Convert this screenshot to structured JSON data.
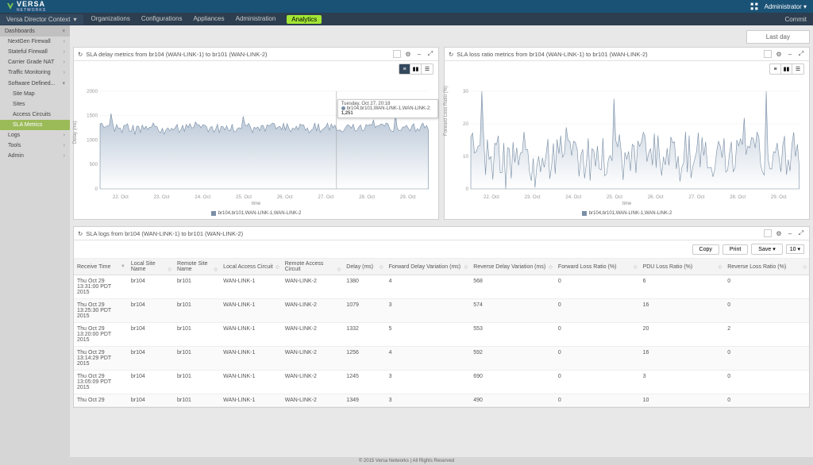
{
  "brand": {
    "name": "VERSA",
    "sub": "NETWORKS"
  },
  "user": {
    "name": "Administrator"
  },
  "context": "Versa Director Context",
  "nav": {
    "items": [
      "Organizations",
      "Configurations",
      "Appliances",
      "Administration",
      "Analytics"
    ],
    "active": 4,
    "commit": "Commit"
  },
  "timerange": "Last day",
  "sidebar": {
    "header": "Dashboards",
    "groups": [
      {
        "label": "NextGen Firewall"
      },
      {
        "label": "Stateful Firewall"
      },
      {
        "label": "Carrier Grade NAT"
      },
      {
        "label": "Traffic Monitoring"
      },
      {
        "label": "Software Defined...",
        "open": true,
        "children": [
          {
            "label": "Site Map"
          },
          {
            "label": "Sites"
          },
          {
            "label": "Access Circuits"
          },
          {
            "label": "SLA Metrics",
            "selected": true
          }
        ]
      },
      {
        "label": "Logs"
      },
      {
        "label": "Tools"
      },
      {
        "label": "Admin"
      }
    ]
  },
  "panels": {
    "delay": {
      "title": "SLA delay metrics from br104 (WAN-LINK-1) to br101 (WAN-LINK-2)",
      "ylabel": "Delay (ms)",
      "xlabel": "time",
      "legend": "br104,br101,WAN-LINK-1,WAN-LINK-2",
      "tooltip": {
        "header": "Tuesday, Oct 27, 20:18",
        "series": "br104,br101,WAN-LINK-1,WAN-LINK-2:",
        "value": "1,251"
      }
    },
    "loss": {
      "title": "SLA loss ratio metrics from br104 (WAN-LINK-1) to br101 (WAN-LINK-2)",
      "ylabel": "Forward Loss Ratio (%)",
      "xlabel": "time",
      "legend": "br104,br101,WAN-LINK-1,WAN-LINK-2"
    },
    "logs": {
      "title": "SLA logs from br104 (WAN-LINK-1) to br101 (WAN-LINK-2)",
      "buttons": {
        "copy": "Copy",
        "print": "Print",
        "save": "Save"
      },
      "pagesize": "10"
    }
  },
  "chart_data": [
    {
      "type": "area",
      "title": "SLA delay metrics from br104 (WAN-LINK-1) to br101 (WAN-LINK-2)",
      "xlabel": "time",
      "ylabel": "Delay (ms)",
      "ylim": [
        0,
        2000
      ],
      "yticks": [
        0,
        500,
        1000,
        1500,
        2000
      ],
      "xticks": [
        "22. Oct",
        "23. Oct",
        "24. Oct",
        "25. Oct",
        "26. Oct",
        "27. Oct",
        "28. Oct",
        "29. Oct"
      ],
      "series": [
        {
          "name": "br104,br101,WAN-LINK-1,WAN-LINK-2",
          "approx_mean": 1250,
          "approx_min": 1100,
          "approx_max": 1450,
          "note": "dense noisy series ~150 points oscillating around 1250 ms"
        }
      ],
      "tooltip_sample": {
        "x": "Tuesday, Oct 27, 20:18",
        "y": 1251
      }
    },
    {
      "type": "area",
      "title": "SLA loss ratio metrics from br104 (WAN-LINK-1) to br101 (WAN-LINK-2)",
      "xlabel": "time",
      "ylabel": "Forward Loss Ratio (%)",
      "ylim": [
        0,
        30
      ],
      "yticks": [
        0,
        10,
        20,
        30
      ],
      "xticks": [
        "22. Oct",
        "23. Oct",
        "24. Oct",
        "25. Oct",
        "26. Oct",
        "27. Oct",
        "28. Oct",
        "29. Oct"
      ],
      "series": [
        {
          "name": "br104,br101,WAN-LINK-1,WAN-LINK-2",
          "approx_mean": 10,
          "approx_min": 2,
          "approx_max": 28,
          "note": "dense spiky series ~150 points mostly 5–15% with spikes to ~25%"
        }
      ]
    }
  ],
  "table": {
    "columns": [
      "Receive Time",
      "Local Site Name",
      "Remote Site Name",
      "Local Access Circuit",
      "Remote Access Circuit",
      "Delay (ms)",
      "Forward Delay Variation (ms)",
      "Reverse Delay Variation (ms)",
      "Forward Loss Ratio (%)",
      "PDU Loss Ratio (%)",
      "Reverse Loss Ratio (%)"
    ],
    "rows": [
      {
        "time": "Thu Oct 29 13:31:00 PDT 2015",
        "lsite": "br104",
        "rsite": "br101",
        "lac": "WAN-LINK-1",
        "rac": "WAN-LINK-2",
        "delay": "1380",
        "fdv": "4",
        "rdv": "568",
        "flr": "0",
        "plr": "6",
        "rlr": "0"
      },
      {
        "time": "Thu Oct 29 13:25:30 PDT 2015",
        "lsite": "br104",
        "rsite": "br101",
        "lac": "WAN-LINK-1",
        "rac": "WAN-LINK-2",
        "delay": "1079",
        "fdv": "3",
        "rdv": "574",
        "flr": "0",
        "plr": "16",
        "rlr": "0"
      },
      {
        "time": "Thu Oct 29 13:20:00 PDT 2015",
        "lsite": "br104",
        "rsite": "br101",
        "lac": "WAN-LINK-1",
        "rac": "WAN-LINK-2",
        "delay": "1332",
        "fdv": "5",
        "rdv": "553",
        "flr": "0",
        "plr": "20",
        "rlr": "2"
      },
      {
        "time": "Thu Oct 29 13:14:29 PDT 2015",
        "lsite": "br104",
        "rsite": "br101",
        "lac": "WAN-LINK-1",
        "rac": "WAN-LINK-2",
        "delay": "1256",
        "fdv": "4",
        "rdv": "592",
        "flr": "0",
        "plr": "16",
        "rlr": "0"
      },
      {
        "time": "Thu Oct 29 13:05:09 PDT 2015",
        "lsite": "br104",
        "rsite": "br101",
        "lac": "WAN-LINK-1",
        "rac": "WAN-LINK-2",
        "delay": "1245",
        "fdv": "3",
        "rdv": "690",
        "flr": "0",
        "plr": "3",
        "rlr": "0"
      },
      {
        "time": "Thu Oct 29",
        "lsite": "br104",
        "rsite": "br101",
        "lac": "WAN-LINK-1",
        "rac": "WAN-LINK-2",
        "delay": "1349",
        "fdv": "3",
        "rdv": "490",
        "flr": "0",
        "plr": "10",
        "rlr": "0"
      }
    ]
  },
  "footer": "© 2015 Versa Networks  |  All Rights Reserved"
}
